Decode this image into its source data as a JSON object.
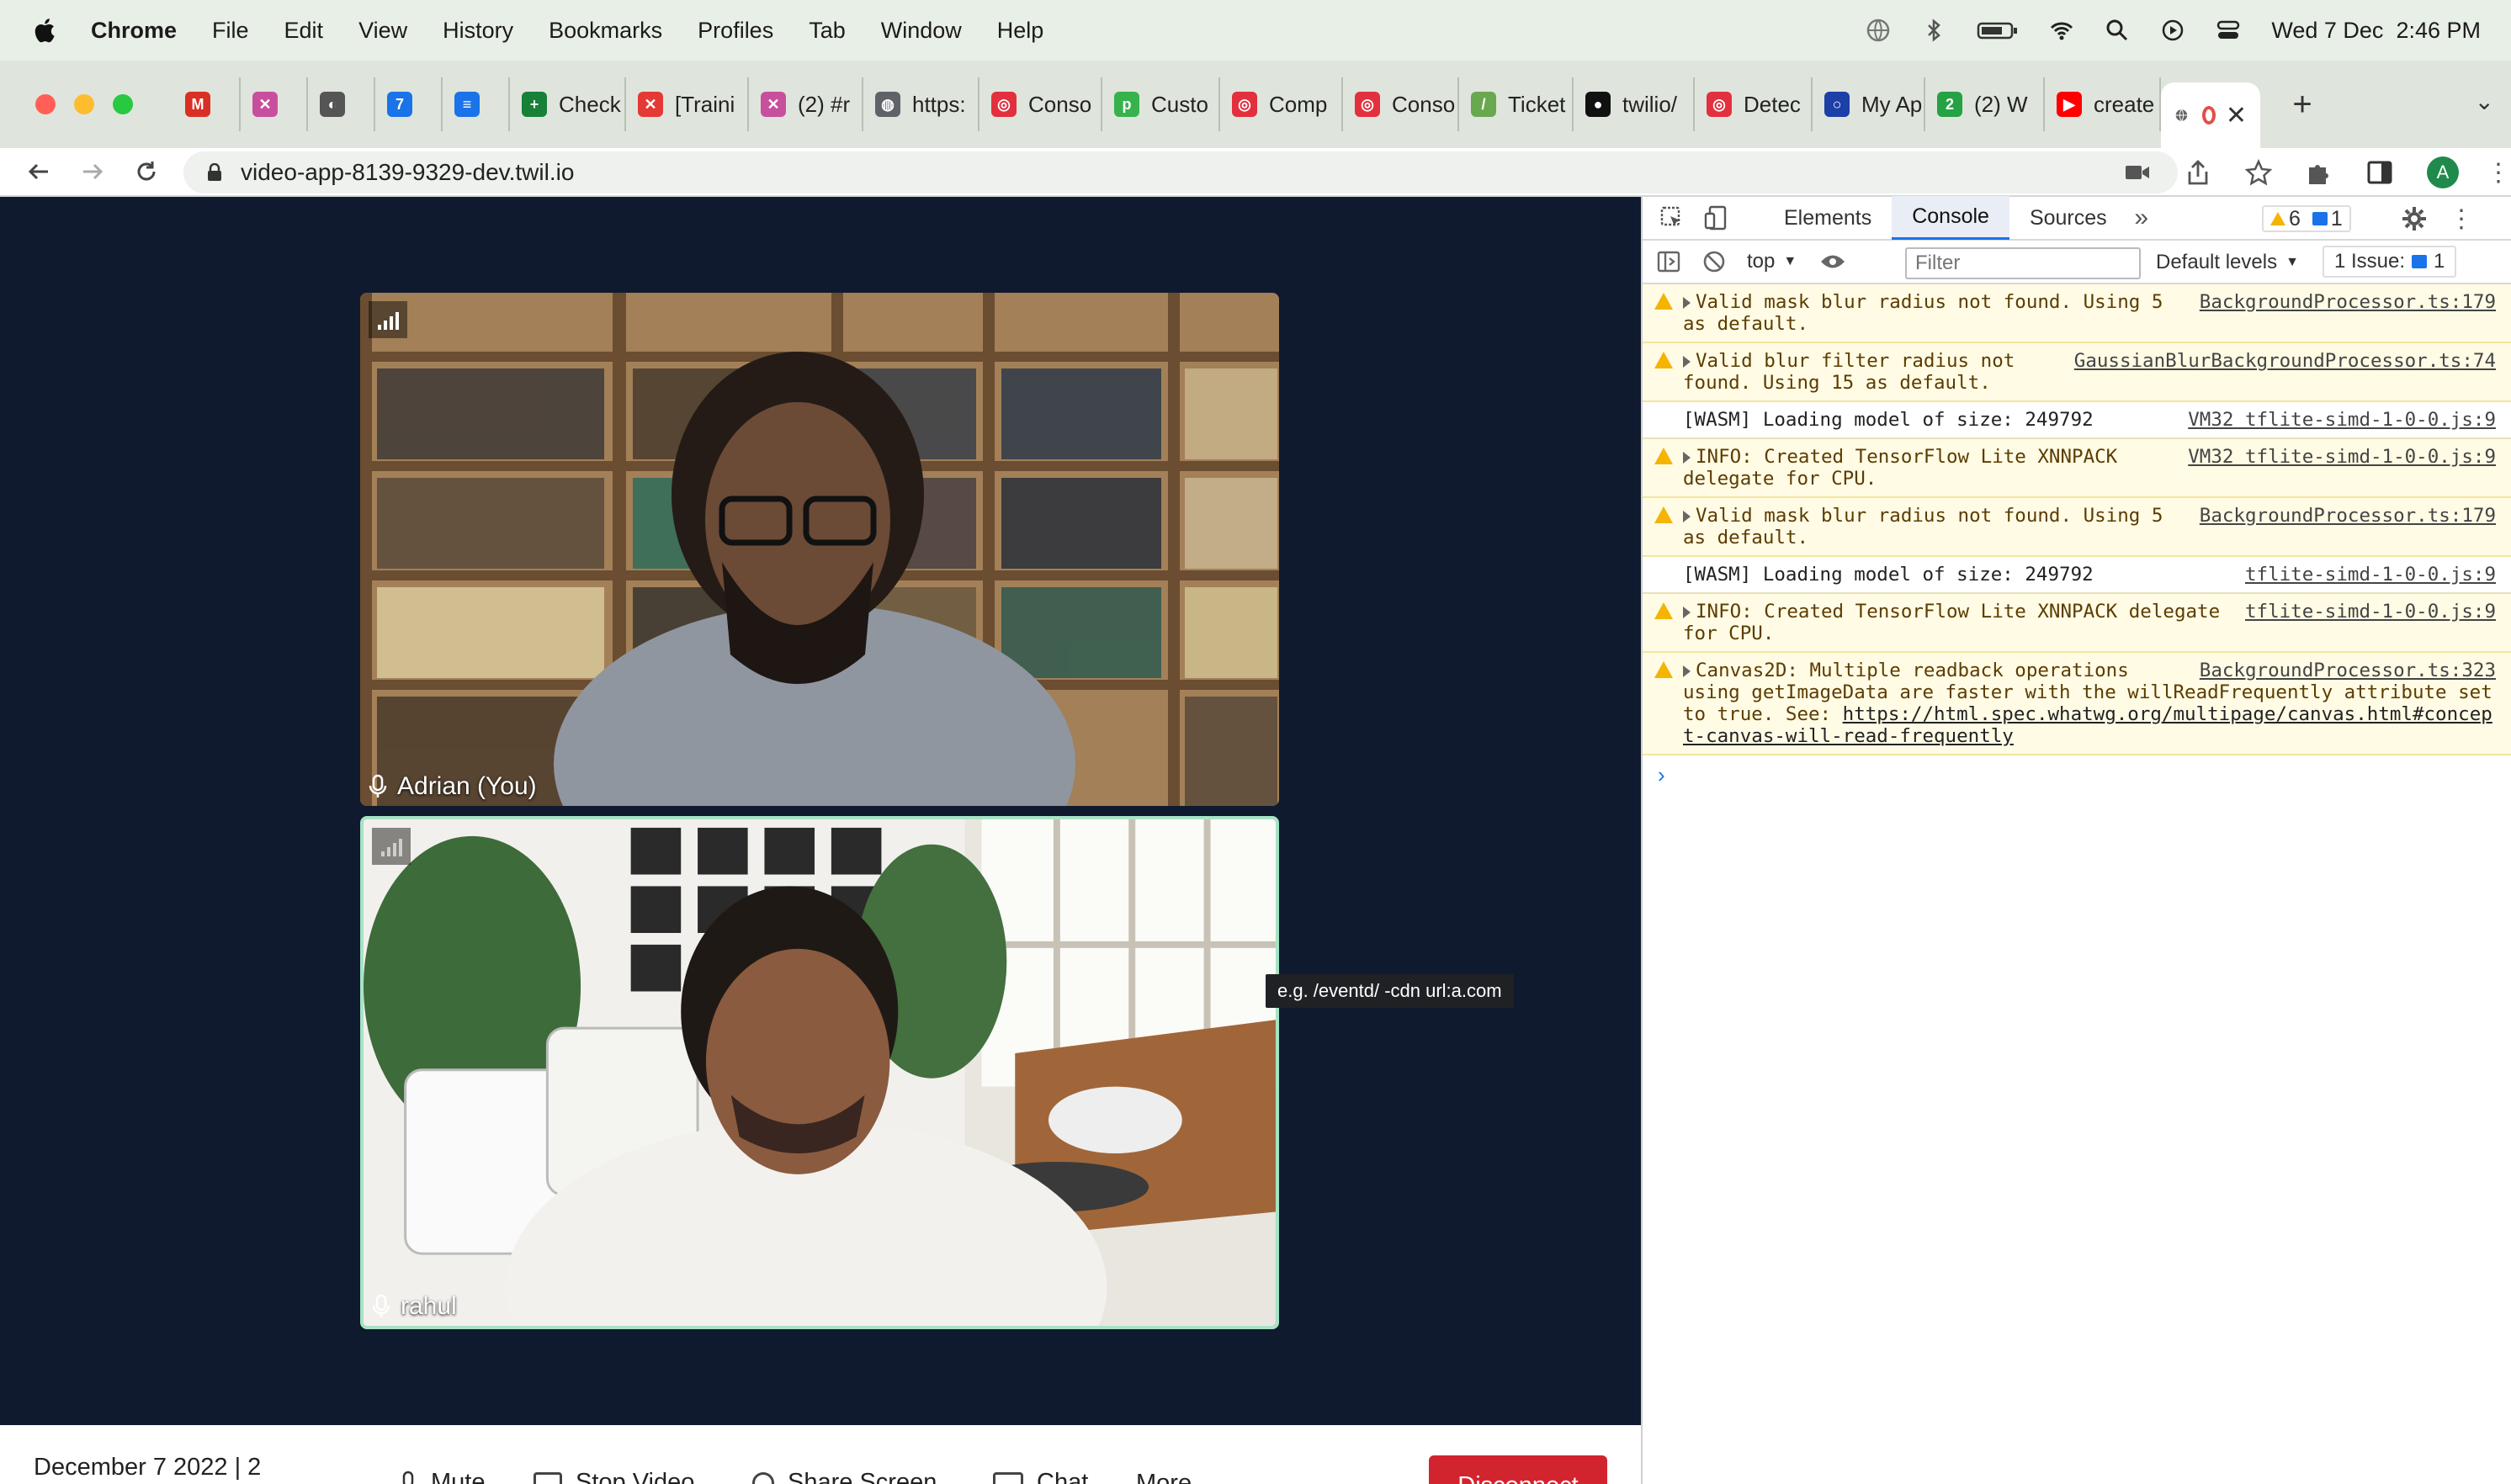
{
  "menubar": {
    "items": [
      "Chrome",
      "File",
      "Edit",
      "View",
      "History",
      "Bookmarks",
      "Profiles",
      "Tab",
      "Window",
      "Help"
    ],
    "clock": "Wed 7 Dec  2:46 PM"
  },
  "tabs": [
    {
      "label": "",
      "color": "#d93025",
      "glyph": "M"
    },
    {
      "label": "",
      "color": "#c84f9e",
      "glyph": "✕"
    },
    {
      "label": "",
      "color": "#555555",
      "glyph": "◐"
    },
    {
      "label": "",
      "color": "#1a73e8",
      "glyph": "7"
    },
    {
      "label": "",
      "color": "#1a73e8",
      "glyph": "≡"
    },
    {
      "label": "Check",
      "color": "#188038",
      "glyph": "+"
    },
    {
      "label": "[Traini",
      "color": "#e53935",
      "glyph": "✕"
    },
    {
      "label": "(2) #r",
      "color": "#c84f9e",
      "glyph": "✕"
    },
    {
      "label": "https:",
      "color": "#5f6368",
      "glyph": "◍"
    },
    {
      "label": "Conso",
      "color": "#e3303e",
      "glyph": "◎"
    },
    {
      "label": "Custo",
      "color": "#37b24d",
      "glyph": "p"
    },
    {
      "label": "Comp",
      "color": "#e3303e",
      "glyph": "◎"
    },
    {
      "label": "Conso",
      "color": "#e3303e",
      "glyph": "◎"
    },
    {
      "label": "Ticket",
      "color": "#6aa84f",
      "glyph": "/"
    },
    {
      "label": "twilio/",
      "color": "#111111",
      "glyph": "●"
    },
    {
      "label": "Detec",
      "color": "#e3303e",
      "glyph": "◎"
    },
    {
      "label": "My Ap",
      "color": "#1c3fa8",
      "glyph": "○"
    },
    {
      "label": "(2) W",
      "color": "#25a244",
      "glyph": "2"
    },
    {
      "label": "create",
      "color": "#ff0000",
      "glyph": "▶"
    }
  ],
  "address": {
    "url": "video-app-8139-9329-dev.twil.io"
  },
  "profile": {
    "initial": "A"
  },
  "video": {
    "participants": [
      {
        "name": "Adrian (You)"
      },
      {
        "name": "rahul"
      }
    ],
    "tooltip": "e.g. /eventd/ -cdn url:a.com"
  },
  "footer": {
    "info": "December 7 2022 | 2",
    "mute": "Mute",
    "stop_video": "Stop Video",
    "share_screen": "Share Screen",
    "chat": "Chat",
    "more": "More",
    "disconnect": "Disconnect"
  },
  "devtools": {
    "tabs": [
      "Elements",
      "Console",
      "Sources"
    ],
    "warning_count": "6",
    "message_count": "1",
    "context": "top",
    "filter_placeholder": "Filter",
    "levels": "Default levels",
    "issues_label": "1 Issue:",
    "issues_count": "1",
    "logs": [
      {
        "level": "warn",
        "expand": true,
        "text": "Valid mask blur radius not found. Using 5 as default.",
        "source": "BackgroundProcessor.ts:179"
      },
      {
        "level": "warn",
        "expand": true,
        "text": "Valid blur filter radius not found. Using 15 as default.",
        "source": "GaussianBlurBackgroundProcessor.ts:74"
      },
      {
        "level": "info",
        "expand": false,
        "text": "[WASM] Loading model of size: 249792",
        "source": "VM32 tflite-simd-1-0-0.js:9"
      },
      {
        "level": "warn",
        "expand": true,
        "text": "INFO: Created TensorFlow Lite XNNPACK delegate for CPU.",
        "source": "VM32 tflite-simd-1-0-0.js:9"
      },
      {
        "level": "warn",
        "expand": true,
        "text": "Valid mask blur radius not found. Using 5 as default.",
        "source": "BackgroundProcessor.ts:179"
      },
      {
        "level": "info",
        "expand": false,
        "text": "[WASM] Loading model of size: 249792",
        "source": "tflite-simd-1-0-0.js:9"
      },
      {
        "level": "warn",
        "expand": true,
        "text": "INFO: Created TensorFlow Lite XNNPACK delegate for CPU.",
        "source": "tflite-simd-1-0-0.js:9"
      },
      {
        "level": "warn",
        "expand": true,
        "text": "Canvas2D: Multiple readback operations using getImageData are faster with the willReadFrequently attribute set to true. See:",
        "link": "https://html.spec.whatwg.org/multipage/canvas.html#concept-canvas-will-read-frequently",
        "source": "BackgroundProcessor.ts:323"
      }
    ]
  }
}
